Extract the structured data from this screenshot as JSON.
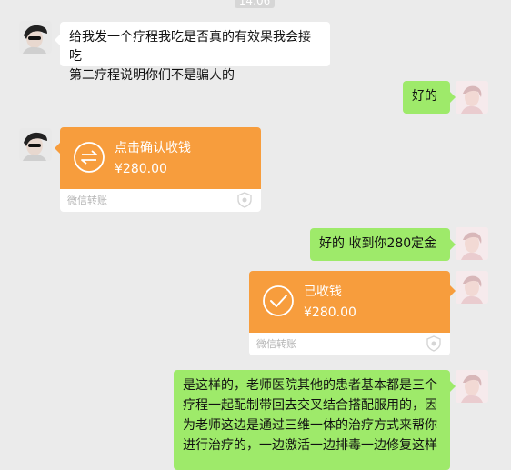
{
  "chat": {
    "timestamp": "14:06",
    "messages": [
      {
        "sender": "contact",
        "type": "text",
        "text": "给我发一个疗程我吃是否真的有效果我会接吃第二疗程说明你们不是骗人的"
      },
      {
        "sender": "me",
        "type": "text",
        "text": "好的"
      },
      {
        "sender": "contact",
        "type": "transfer",
        "title": "点击确认收钱",
        "amount": "¥280.00",
        "footer": "微信转账",
        "icon": "transfer-arrows-icon"
      },
      {
        "sender": "me",
        "type": "text",
        "text": "好的 收到你280定金"
      },
      {
        "sender": "me",
        "type": "transfer",
        "title": "已收钱",
        "amount": "¥280.00",
        "footer": "微信转账",
        "icon": "checkmark-icon"
      },
      {
        "sender": "me",
        "type": "text",
        "text": "是这样的，老师医院其他的患者基本都是三个疗程一起配制带回去交叉结合搭配服用的，因为老师这边是通过三维一体的治疗方式来帮你进行治疗的，一边激活一边排毒一边修复这样"
      }
    ]
  },
  "msg1_line1": "给我发一个疗程我吃是否真的有效果我会接吃",
  "msg1_line2": "第二疗程说明你们不是骗人的",
  "msg6_line1": "是这样的，老师医院其他的患者基本都是三个",
  "msg6_line2": "疗程一起配制带回去交叉结合搭配服用的，因",
  "msg6_line3": "为老师这边是通过三维一体的治疗方式来帮你",
  "msg6_line4": "进行治疗的，一边激活一边排毒一边修复这样",
  "colors": {
    "background": "#ebebeb",
    "me_bubble": "#9eea6a",
    "contact_bubble": "#ffffff",
    "transfer": "#f79d3d"
  }
}
